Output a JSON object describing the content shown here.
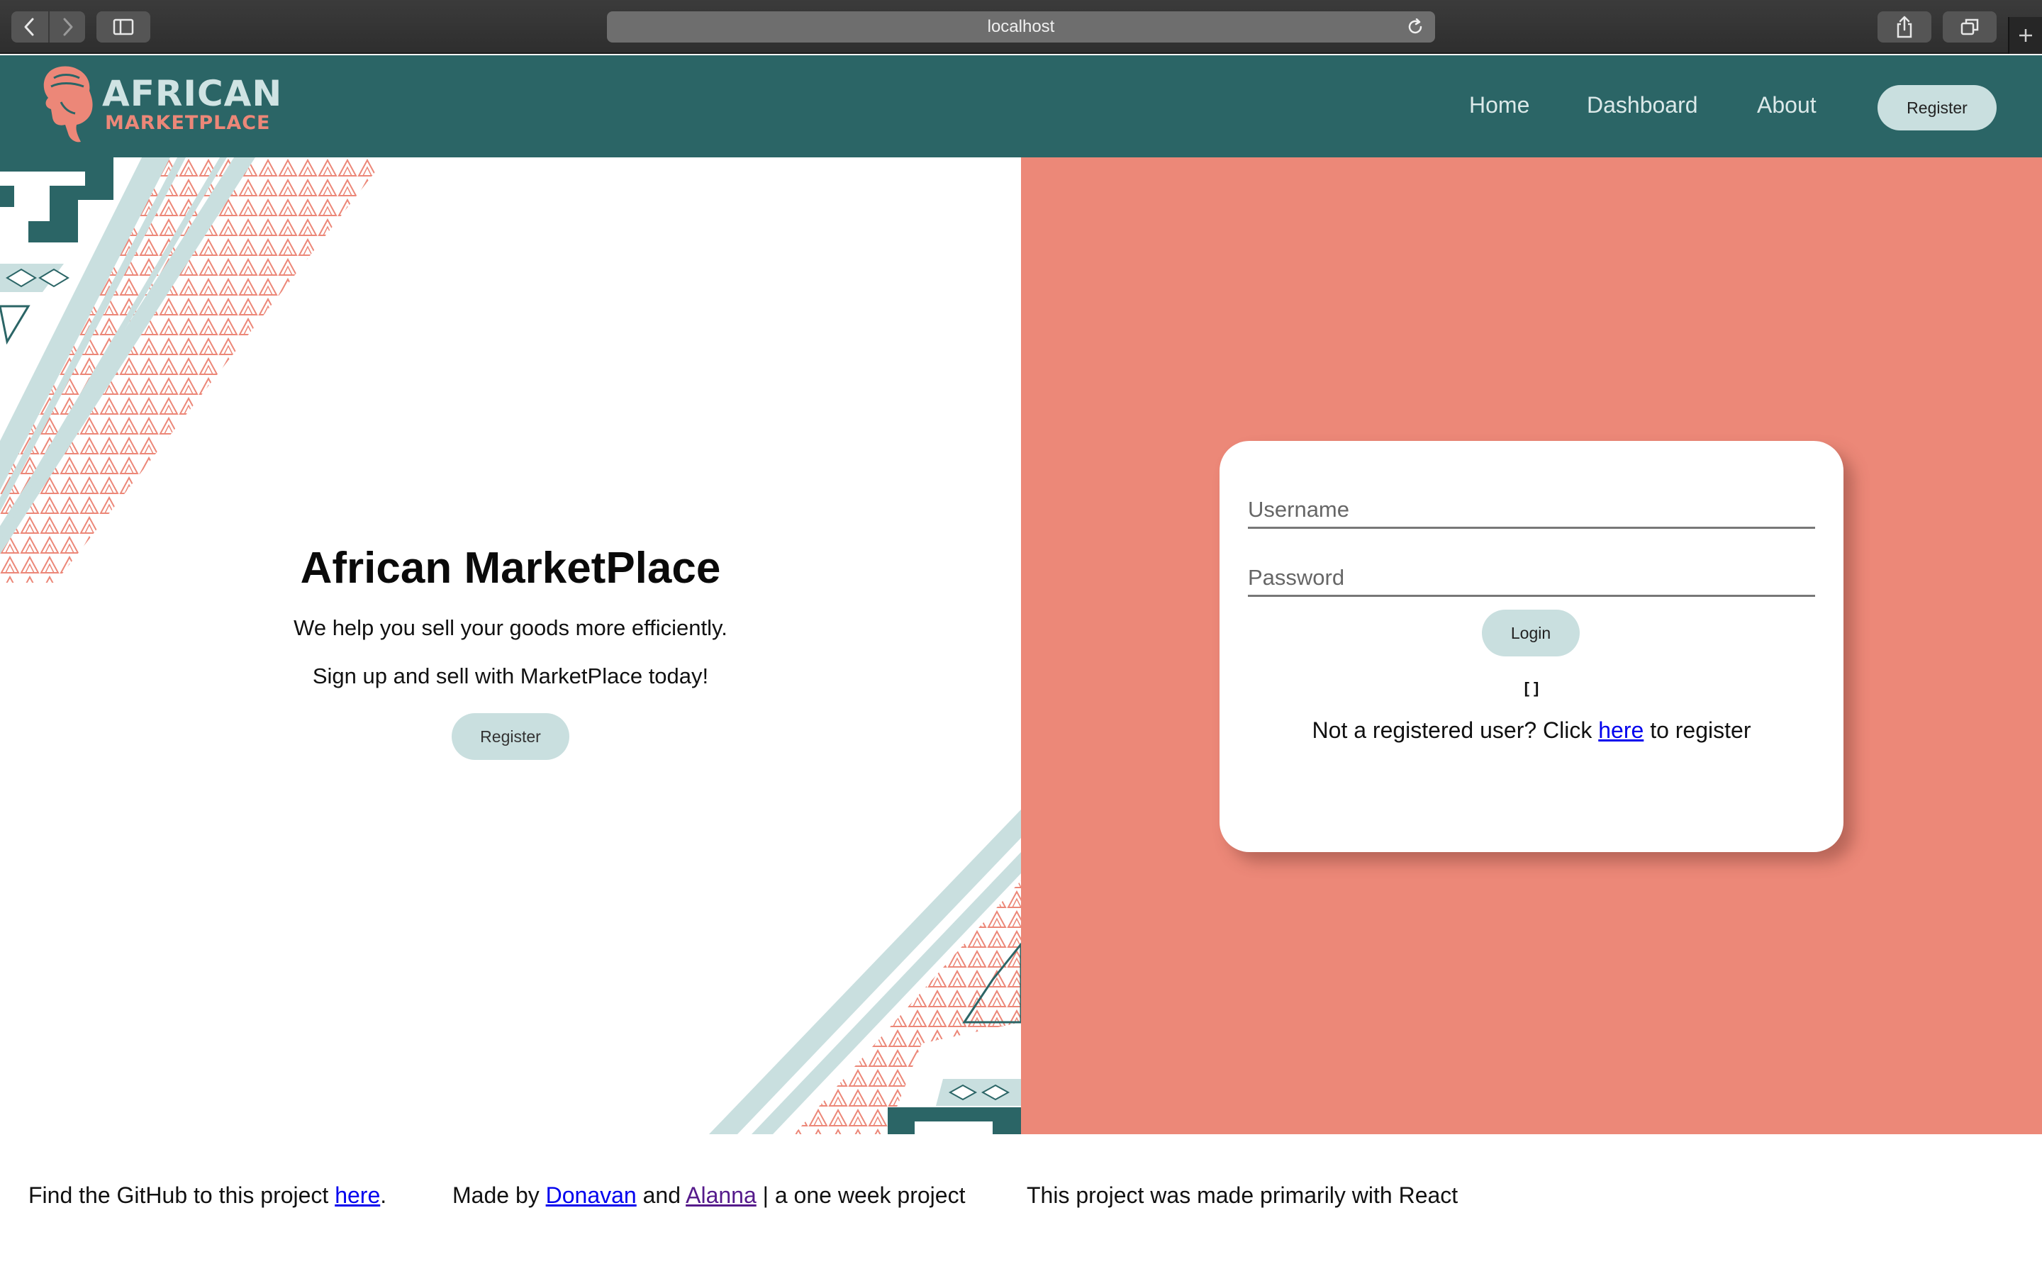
{
  "browser": {
    "url": "localhost",
    "icons": {
      "back": "chevron-left-icon",
      "forward": "chevron-right-icon",
      "sidebar": "sidebar-icon",
      "reload": "reload-icon",
      "share": "share-icon",
      "tabs": "tabs-overview-icon",
      "new_tab": "plus-icon"
    }
  },
  "header": {
    "logo": {
      "line1": "AFRICAN",
      "line2": "MARKETPLACE"
    },
    "nav": {
      "home": "Home",
      "dashboard": "Dashboard",
      "about": "About",
      "register": "Register"
    }
  },
  "hero": {
    "title": "African MarketPlace",
    "subtitle1": "We help you sell your goods more efficiently.",
    "subtitle2": "Sign up and sell with MarketPlace today!",
    "register": "Register"
  },
  "login": {
    "username_placeholder": "Username",
    "password_placeholder": "Password",
    "login_button": "Login",
    "errors": "[ ]",
    "note_prefix": "Not a registered user? Click ",
    "note_link": "here",
    "note_suffix": " to register"
  },
  "footer": {
    "github_prefix": "Find the GitHub to this project ",
    "github_link": "here",
    "github_suffix": ".",
    "made_by_prefix": "Made by ",
    "author1": "Donavan",
    "and": " and ",
    "author2": "Alanna",
    "made_by_suffix": " | a one week project",
    "tech_note": "This project was made primarily with React"
  },
  "colors": {
    "header_bg": "#2b6566",
    "coral": "#ec8878",
    "mint": "#c9dfdf",
    "link": "#0000ee",
    "visited_link": "#551a8b"
  }
}
